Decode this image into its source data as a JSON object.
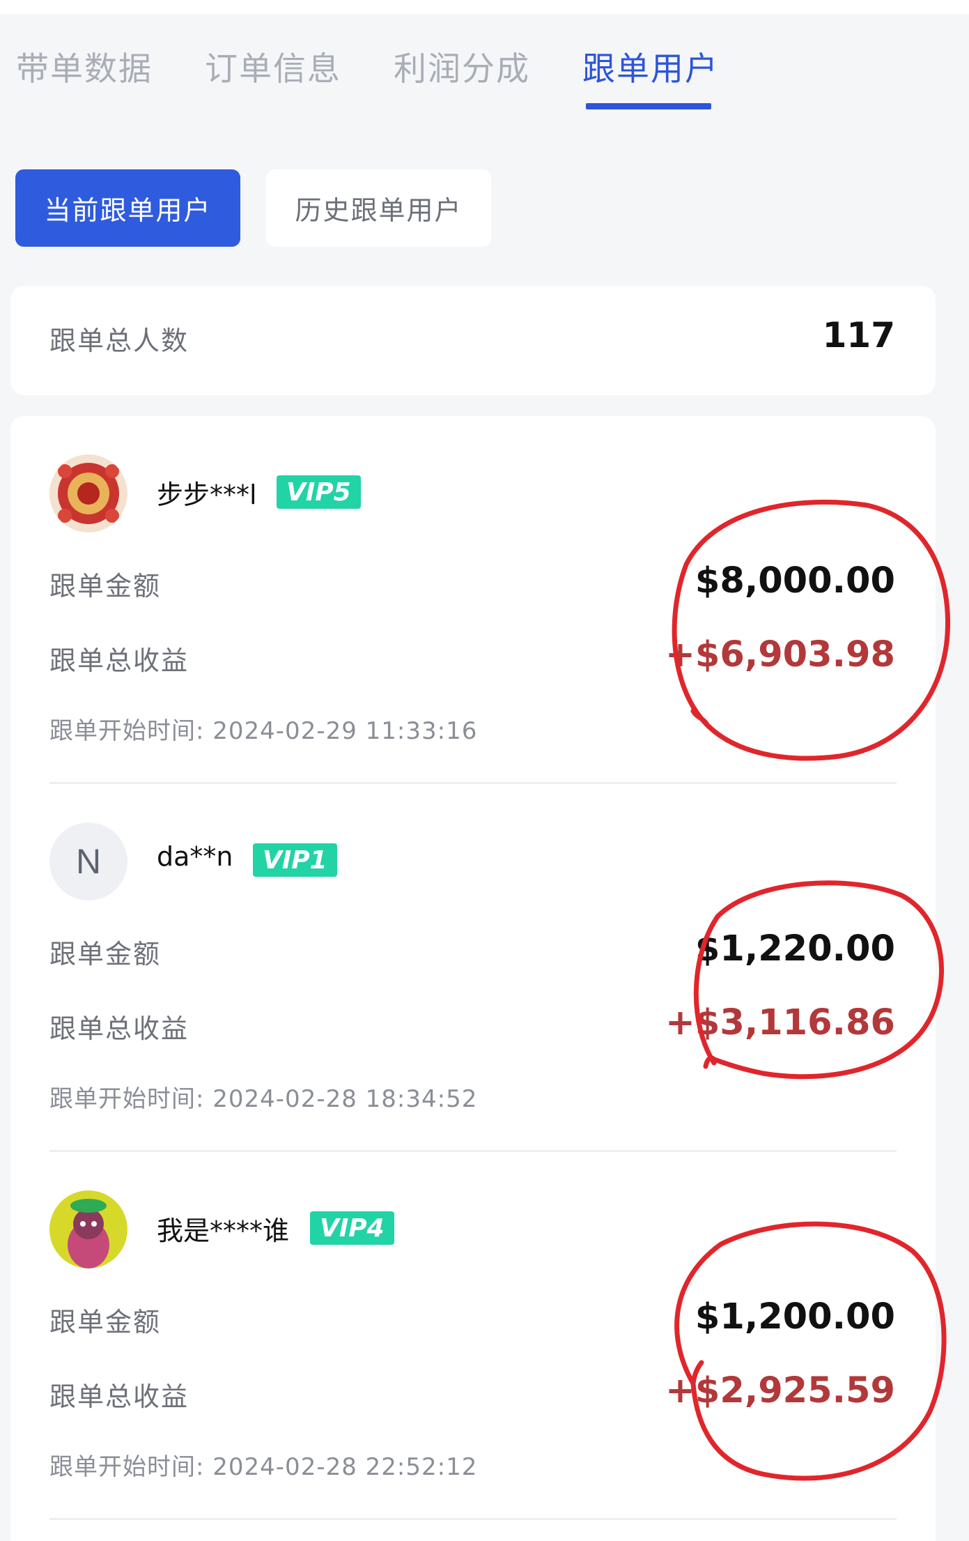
{
  "tabs": [
    {
      "label": "带单数据",
      "active": false
    },
    {
      "label": "订单信息",
      "active": false
    },
    {
      "label": "利润分成",
      "active": false
    },
    {
      "label": "跟单用户",
      "active": true
    }
  ],
  "segments": {
    "current": "当前跟单用户",
    "history": "历史跟单用户"
  },
  "summary": {
    "label": "跟单总人数",
    "value": "117"
  },
  "users": [
    {
      "name": "步步***l",
      "vip": "VIP5",
      "amount_label": "跟单金额",
      "amount": "$8,000.00",
      "profit_label": "跟单总收益",
      "profit": "+$6,903.98",
      "start_time": "跟单开始时间: 2024-02-29 11:33:16",
      "avatar": "red-festive-pattern"
    },
    {
      "name": "da**n",
      "vip": "VIP1",
      "amount_label": "跟单金额",
      "amount": "$1,220.00",
      "profit_label": "跟单总收益",
      "profit": "+$3,116.86",
      "start_time": "跟单开始时间: 2024-02-28 18:34:52",
      "avatar_letter": "N"
    },
    {
      "name": "我是****谁",
      "vip": "VIP4",
      "amount_label": "跟单金额",
      "amount": "$1,200.00",
      "profit_label": "跟单总收益",
      "profit": "+$2,925.59",
      "start_time": "跟单开始时间: 2024-02-28 22:52:12",
      "avatar": "cartoon-ape-yellow"
    }
  ],
  "colors": {
    "accent": "#2d55d9",
    "vip": "#22d3a6",
    "profit": "#b2383a",
    "annotation": "#e0262b"
  }
}
